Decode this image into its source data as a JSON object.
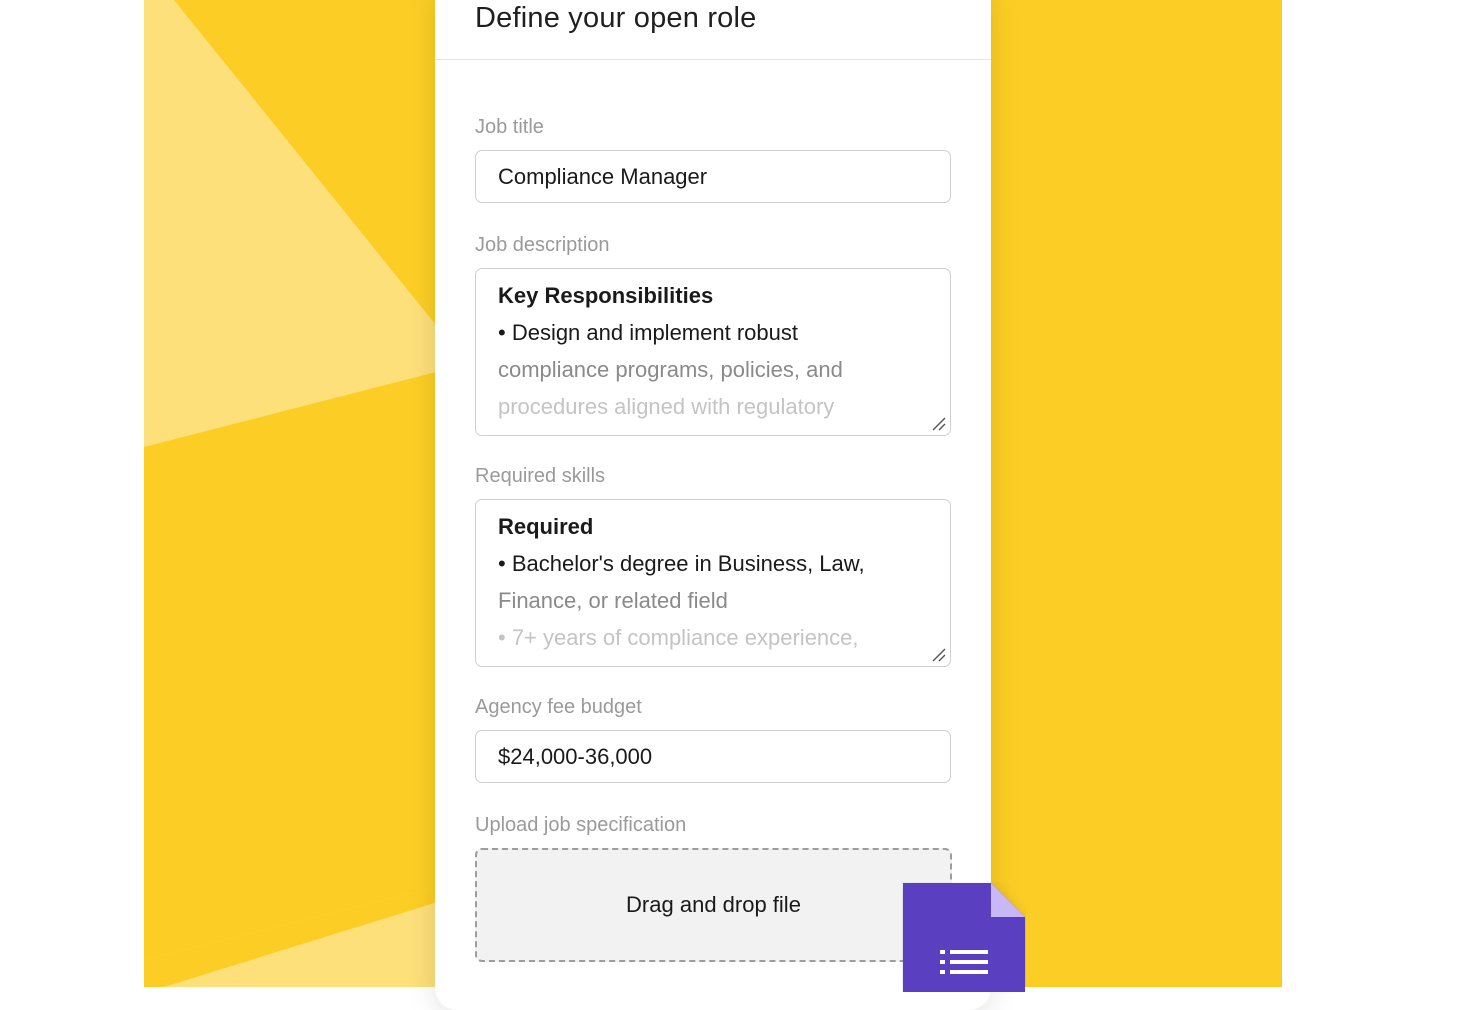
{
  "form": {
    "title": "Define your open role",
    "job_title": {
      "label": "Job title",
      "value": "Compliance Manager"
    },
    "job_description": {
      "label": "Job description",
      "lines": [
        "Key Responsibilities",
        "• Design and implement robust",
        "compliance programs, policies, and",
        "procedures aligned with regulatory"
      ]
    },
    "required_skills": {
      "label": "Required skills",
      "lines": [
        "Required",
        "• Bachelor's degree in Business, Law,",
        "Finance, or related field",
        "• 7+ years of compliance experience,"
      ]
    },
    "agency_fee": {
      "label": "Agency fee budget",
      "value": "$24,000-36,000"
    },
    "upload": {
      "label": "Upload job specification",
      "dropzone_text": "Drag and drop file"
    }
  },
  "colors": {
    "background_yellow": "#fcce25",
    "file_icon_purple": "#5a3fc0",
    "file_icon_fold": "#c9b8f7"
  },
  "icons": {
    "file_icon": "document-list-icon",
    "resize_handle": "resize-grip-icon"
  }
}
